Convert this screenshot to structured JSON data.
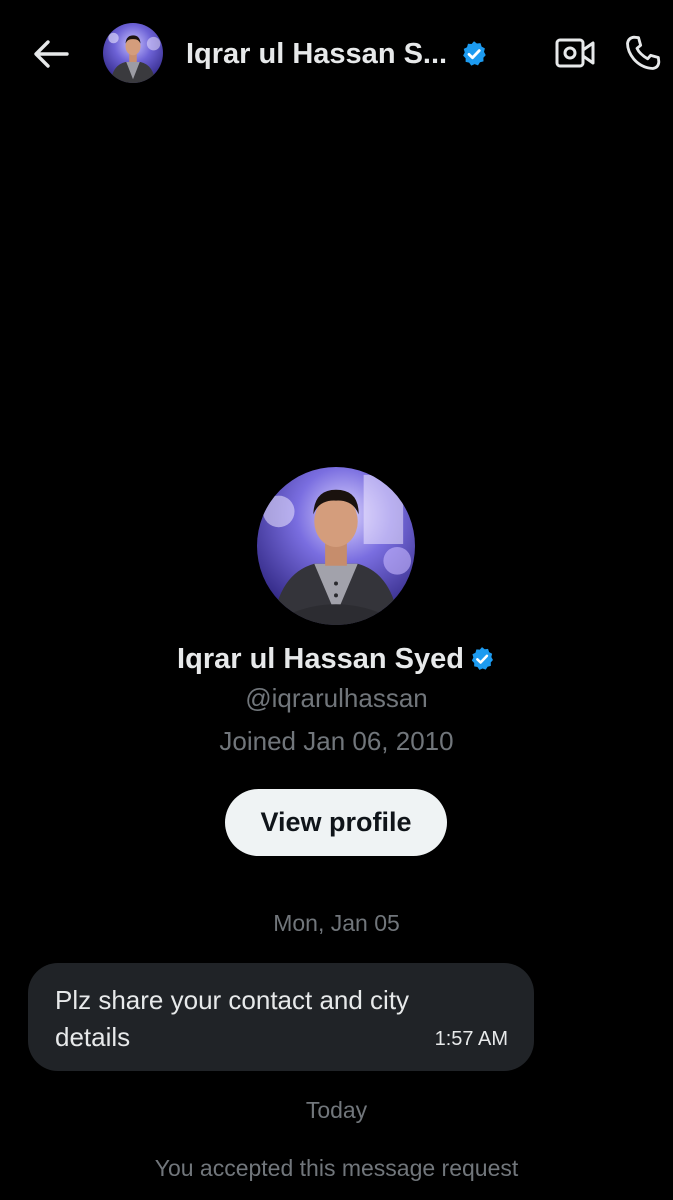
{
  "header": {
    "back_icon": "arrow-left-icon",
    "name": "Iqrar ul Hassan S...",
    "verified_icon": "verified-badge-icon",
    "video_icon": "video-camera-icon",
    "call_icon": "phone-icon"
  },
  "profile": {
    "name": "Iqrar ul Hassan Syed",
    "handle": "@iqrarulhassan",
    "joined": "Joined Jan 06, 2010",
    "view_profile_label": "View profile"
  },
  "conversation": {
    "date_1": "Mon, Jan 05",
    "messages": [
      {
        "text": "Plz share your contact and city details",
        "time": "1:57 AM"
      }
    ],
    "date_2": "Today",
    "system_message": "You accepted this message request"
  },
  "colors": {
    "background": "#000000",
    "primary_text": "#e7e9ea",
    "secondary_text": "#71767b",
    "verified_blue": "#1d9bf0",
    "bubble_bg": "#202327",
    "button_bg": "#eff3f4"
  }
}
